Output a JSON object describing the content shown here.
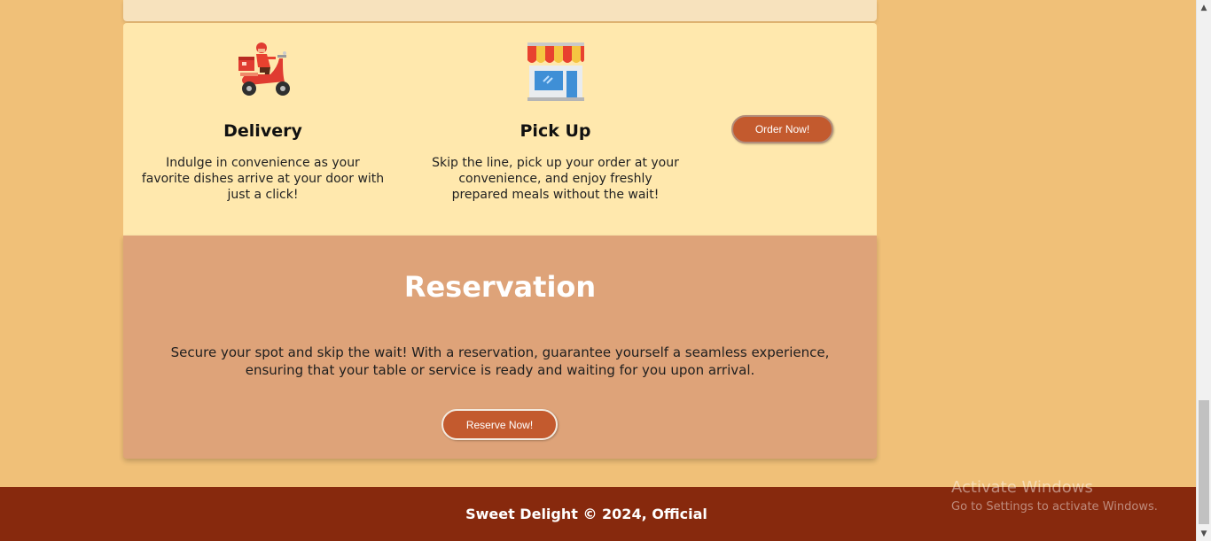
{
  "order_section": {
    "delivery": {
      "icon": "delivery-scooter-icon",
      "title": "Delivery",
      "description": "Indulge in convenience as your favorite dishes arrive at your door with just a click!"
    },
    "pickup": {
      "icon": "storefront-icon",
      "title": "Pick Up",
      "description": "Skip the line, pick up your order at your convenience, and enjoy freshly prepared meals without the wait!"
    },
    "order_button_label": "Order Now!"
  },
  "reservation": {
    "title": "Reservation",
    "description": "Secure your spot and skip the wait! With a reservation, guarantee yourself a seamless experience, ensuring that your table or service is ready and waiting for you upon arrival.",
    "button_label": "Reserve Now!"
  },
  "footer": {
    "text": "Sweet Delight © 2024, Official"
  },
  "watermark": {
    "title": "Activate Windows",
    "subtitle": "Go to Settings to activate Windows."
  },
  "scrollbar": {
    "up_arrow": "▲",
    "down_arrow": "▼"
  },
  "colors": {
    "page_background": "#f0c078",
    "order_panel": "#ffe8ad",
    "reservation_panel": "#dea379",
    "button": "#c35a2e",
    "footer": "#87290d"
  }
}
